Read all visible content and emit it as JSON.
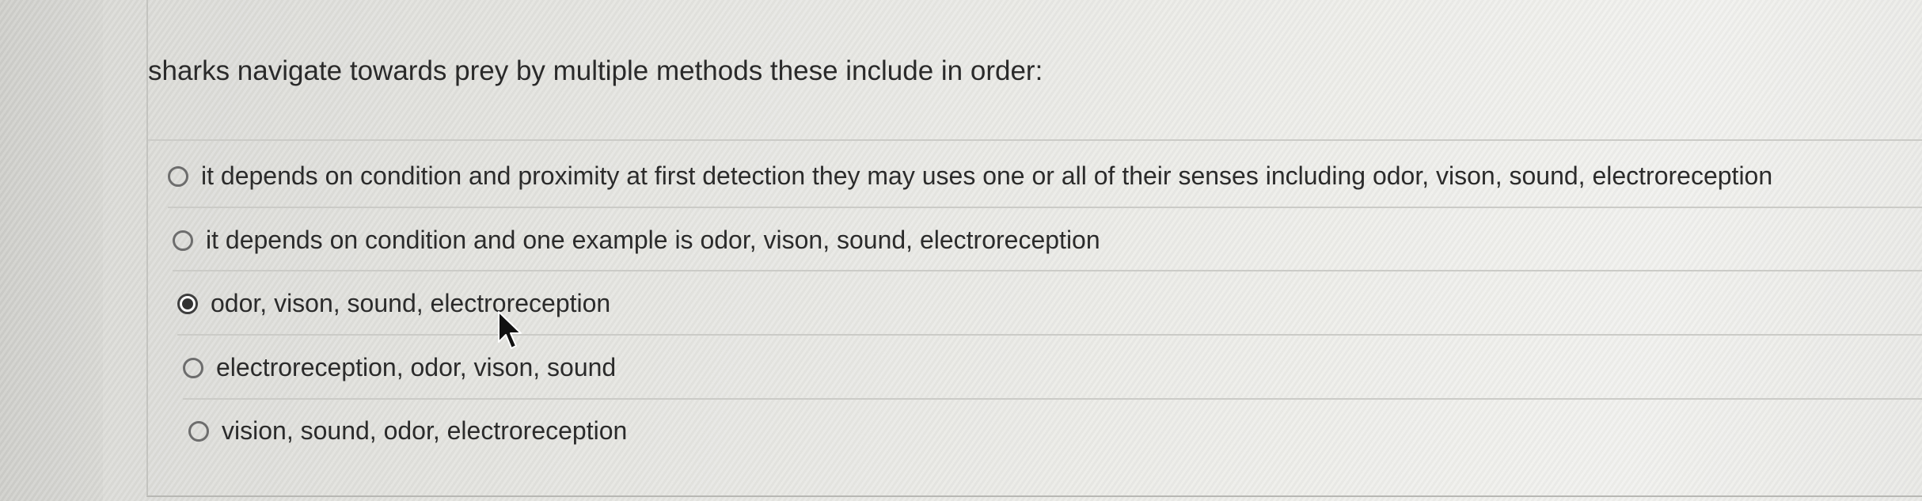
{
  "question": {
    "text": "sharks navigate towards prey by multiple methods these include in order:"
  },
  "options": [
    {
      "label": "it depends on condition and proximity at first detection they may uses one or all of their senses including odor, vison, sound, electroreception",
      "selected": false
    },
    {
      "label": "it depends on condition and one example is odor, vison, sound, electroreception",
      "selected": false
    },
    {
      "label": "odor, vison, sound, electroreception",
      "selected": true
    },
    {
      "label": "electroreception, odor, vison, sound",
      "selected": false
    },
    {
      "label": "vision, sound, odor, electroreception",
      "selected": false
    }
  ],
  "colors": {
    "background": "#e6e6e2",
    "text": "#2b2b2b",
    "radio_border": "#6d6d6d",
    "radio_selected_fill": "#333333",
    "divider": "#cbcbc7"
  },
  "icons": {
    "cursor": "mouse-pointer-icon"
  }
}
